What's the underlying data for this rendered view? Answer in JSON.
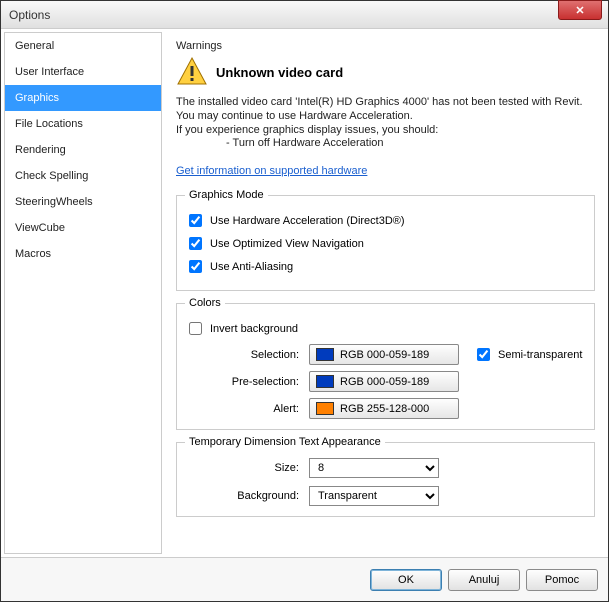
{
  "window": {
    "title": "Options"
  },
  "sidebar": {
    "items": [
      {
        "label": "General"
      },
      {
        "label": "User Interface"
      },
      {
        "label": "Graphics"
      },
      {
        "label": "File Locations"
      },
      {
        "label": "Rendering"
      },
      {
        "label": "Check Spelling"
      },
      {
        "label": "SteeringWheels"
      },
      {
        "label": "ViewCube"
      },
      {
        "label": "Macros"
      }
    ],
    "selected_index": 2
  },
  "warnings": {
    "section_label": "Warnings",
    "title": "Unknown video card",
    "line1": "The installed video card 'Intel(R) HD Graphics 4000' has not been tested with Revit.",
    "line2": "You may continue to use Hardware Acceleration.",
    "line3": "If you experience graphics display issues, you should:",
    "bullet1": "- Turn off Hardware Acceleration",
    "link": "Get information on supported hardware"
  },
  "graphics_mode": {
    "legend": "Graphics Mode",
    "hw_accel": "Use Hardware Acceleration (Direct3D®)",
    "optimized_nav": "Use Optimized View Navigation",
    "anti_aliasing": "Use Anti-Aliasing"
  },
  "colors": {
    "legend": "Colors",
    "invert": "Invert background",
    "selection_label": "Selection:",
    "selection_value": "RGB 000-059-189",
    "selection_hex": "#003bbd",
    "semi_transparent": "Semi-transparent",
    "preselection_label": "Pre-selection:",
    "preselection_value": "RGB 000-059-189",
    "preselection_hex": "#003bbd",
    "alert_label": "Alert:",
    "alert_value": "RGB 255-128-000",
    "alert_hex": "#ff8000"
  },
  "tmpdim": {
    "legend": "Temporary Dimension Text Appearance",
    "size_label": "Size:",
    "size_value": "8",
    "bg_label": "Background:",
    "bg_value": "Transparent"
  },
  "footer": {
    "ok": "OK",
    "cancel": "Anuluj",
    "help": "Pomoc"
  }
}
